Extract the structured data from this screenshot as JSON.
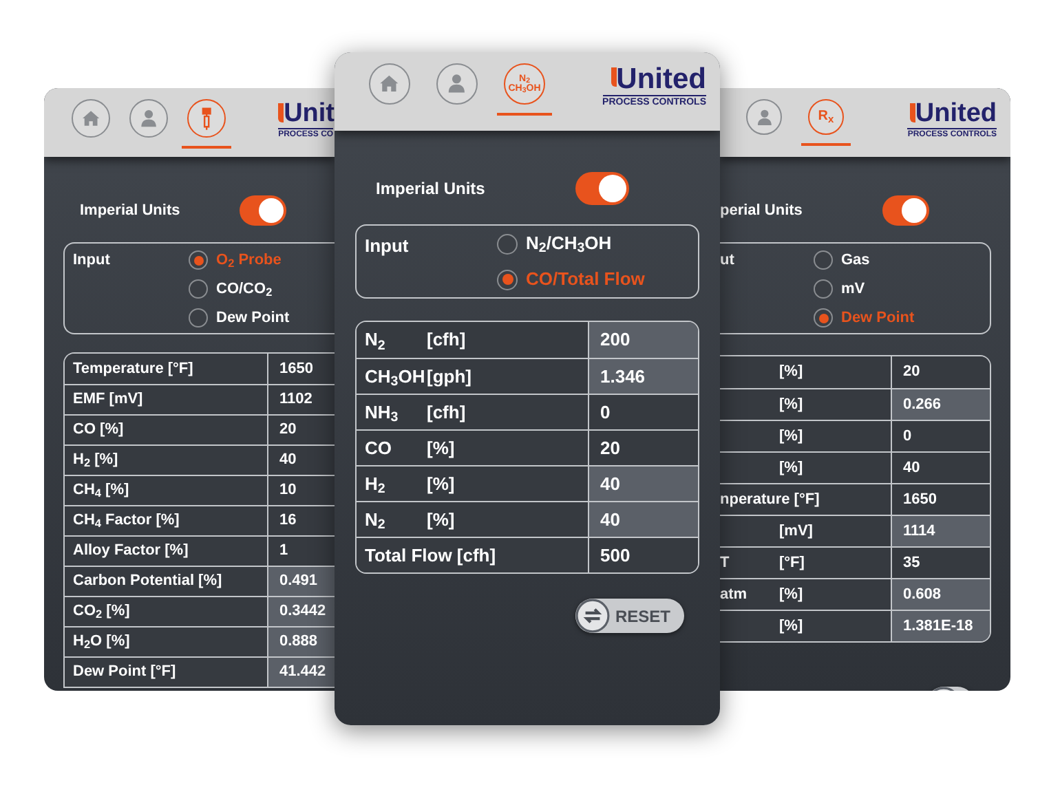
{
  "phones": [
    {
      "tabs": [
        {
          "kind": "home",
          "selected": false
        },
        {
          "kind": "person",
          "selected": false
        },
        {
          "kind": "probe",
          "selected": true
        }
      ],
      "logo": {
        "name": "Unit",
        "tagline": "PROCESS CO"
      },
      "units_toggle": {
        "label": "Imperial Units",
        "on": true
      },
      "input": {
        "label": "Input",
        "options": [
          {
            "label": "O$_{2}$ Probe",
            "selected": true
          },
          {
            "label": "CO/CO$_{2}$",
            "selected": false
          },
          {
            "label": "Dew Point",
            "selected": false
          }
        ]
      },
      "table": {
        "rows": [
          {
            "label": "Temperature [°F]",
            "value": "1650",
            "shaded": false
          },
          {
            "label": "EMF [mV]",
            "value": "1102",
            "shaded": false
          },
          {
            "label": "CO [%]",
            "value": "20",
            "shaded": false
          },
          {
            "label": "H$_{2}$ [%]",
            "value": "40",
            "shaded": false
          },
          {
            "label": "CH$_{4}$ [%]",
            "value": "10",
            "shaded": false
          },
          {
            "label": "CH$_{4}$ Factor [%]",
            "value": "16",
            "shaded": false
          },
          {
            "label": "Alloy Factor [%]",
            "value": "1",
            "shaded": false
          },
          {
            "label": "Carbon Potential [%]",
            "value": "0.491",
            "shaded": true
          },
          {
            "label": "CO$_{2}$ [%]",
            "value": "0.3442",
            "shaded": true
          },
          {
            "label": "H$_{2}$O [%]",
            "value": "0.888",
            "shaded": true
          },
          {
            "label": "Dew Point [°F]",
            "value": "41.442",
            "shaded": true
          }
        ]
      }
    },
    {
      "tabs": [
        {
          "kind": "home",
          "selected": false
        },
        {
          "kind": "person",
          "selected": false
        },
        {
          "kind": "text",
          "lines": [
            "N$_{2}$",
            "CH$_{3}$OH"
          ],
          "selected": true
        }
      ],
      "logo": {
        "name": "United",
        "tagline": "PROCESS CONTROLS"
      },
      "units_toggle": {
        "label": "Imperial Units",
        "on": true
      },
      "input": {
        "label": "Input",
        "options": [
          {
            "label": "N$_{2}$/CH$_{3}$OH",
            "selected": false
          },
          {
            "label": "CO/Total Flow",
            "selected": true
          }
        ]
      },
      "table": {
        "rows": [
          {
            "label": "N$_{2}$",
            "unit": "[cfh]",
            "value": "200",
            "shaded": true
          },
          {
            "label": "CH$_{3}$OH",
            "unit": "[gph]",
            "value": "1.346",
            "shaded": true
          },
          {
            "label": "NH$_{3}$",
            "unit": "[cfh]",
            "value": "0",
            "shaded": false
          },
          {
            "label": "CO",
            "unit": "[%]",
            "value": "20",
            "shaded": false
          },
          {
            "label": "H$_{2}$",
            "unit": "[%]",
            "value": "40",
            "shaded": true
          },
          {
            "label": "N$_{2}$",
            "unit": "[%]",
            "value": "40",
            "shaded": true
          },
          {
            "label": "Total Flow [cfh]",
            "value": "500",
            "shaded": false
          }
        ]
      },
      "reset": {
        "label": "RESET"
      }
    },
    {
      "tabs": [
        {
          "kind": "person",
          "selected": false
        },
        {
          "kind": "text",
          "lines": [
            "R$_{x}$"
          ],
          "selected": true
        }
      ],
      "logo": {
        "name": "United",
        "tagline": "PROCESS CONTROLS"
      },
      "units_toggle": {
        "label": "perial Units",
        "on": true
      },
      "input": {
        "label": "ut",
        "options": [
          {
            "label": "Gas",
            "selected": false
          },
          {
            "label": "mV",
            "selected": false
          },
          {
            "label": "Dew Point",
            "selected": true
          }
        ]
      },
      "table": {
        "rows": [
          {
            "unit": "[%]",
            "value": "20",
            "shaded": false
          },
          {
            "unit": "[%]",
            "value": "0.266",
            "shaded": true
          },
          {
            "unit": "[%]",
            "value": "0",
            "shaded": false
          },
          {
            "unit": "[%]",
            "value": "40",
            "shaded": false
          },
          {
            "label": "nperature [°F]",
            "value": "1650",
            "shaded": false
          },
          {
            "unit": "[mV]",
            "value": "1114",
            "shaded": true
          },
          {
            "label": "T",
            "unit": "[°F]",
            "value": "35",
            "shaded": false
          },
          {
            "label": "atm",
            "unit": "[%]",
            "value": "0.608",
            "shaded": true
          },
          {
            "unit": "[%]",
            "value": "1.381E-18",
            "shaded": true
          }
        ]
      }
    }
  ]
}
